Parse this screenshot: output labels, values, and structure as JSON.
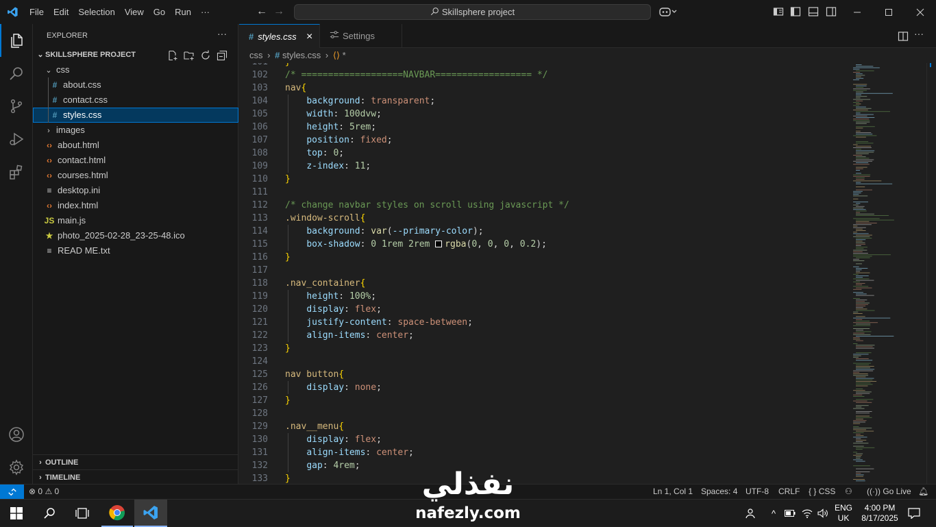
{
  "window": {
    "menu": [
      "File",
      "Edit",
      "Selection",
      "View",
      "Go",
      "Run",
      "···"
    ],
    "search_text": "Skillsphere project"
  },
  "sidebar": {
    "title": "EXPLORER",
    "more": "···",
    "project": "SKILLSPHERE PROJECT",
    "tree": [
      {
        "label": "css",
        "kind": "folder-open",
        "indent": 1
      },
      {
        "label": "about.css",
        "kind": "css",
        "indent": 2
      },
      {
        "label": "contact.css",
        "kind": "css",
        "indent": 2
      },
      {
        "label": "styles.css",
        "kind": "css",
        "indent": 2,
        "selected": true
      },
      {
        "label": "images",
        "kind": "folder",
        "indent": 1
      },
      {
        "label": "about.html",
        "kind": "html",
        "indent": 1
      },
      {
        "label": "contact.html",
        "kind": "html",
        "indent": 1
      },
      {
        "label": "courses.html",
        "kind": "html",
        "indent": 1
      },
      {
        "label": "desktop.ini",
        "kind": "ini",
        "indent": 1
      },
      {
        "label": "index.html",
        "kind": "html",
        "indent": 1
      },
      {
        "label": "main.js",
        "kind": "js",
        "indent": 1
      },
      {
        "label": "photo_2025-02-28_23-25-48.ico",
        "kind": "ico",
        "indent": 1
      },
      {
        "label": "READ ME.txt",
        "kind": "txt",
        "indent": 1
      }
    ],
    "outline": "OUTLINE",
    "timeline": "TIMELINE"
  },
  "tabs": [
    {
      "label": "styles.css",
      "icon": "#",
      "active": true,
      "close": "×"
    },
    {
      "label": "Settings",
      "icon": "settings-icon",
      "active": false
    }
  ],
  "breadcrumb": {
    "folder": "css",
    "file": "styles.css",
    "symbol": "*"
  },
  "editor": {
    "lines": [
      {
        "n": "102",
        "t": [
          [
            "c-com",
            "/* ===================NAVBAR================== */"
          ]
        ]
      },
      {
        "n": "103",
        "t": [
          [
            "c-sel",
            "nav"
          ],
          [
            "c-brace",
            "{"
          ]
        ]
      },
      {
        "n": "104",
        "t": [
          [
            "c-txt",
            "    "
          ],
          [
            "c-prop",
            "background"
          ],
          [
            "c-txt",
            ": "
          ],
          [
            "c-val",
            "transparent"
          ],
          [
            "c-txt",
            ";"
          ]
        ]
      },
      {
        "n": "105",
        "t": [
          [
            "c-txt",
            "    "
          ],
          [
            "c-prop",
            "width"
          ],
          [
            "c-txt",
            ": "
          ],
          [
            "c-num",
            "100dvw"
          ],
          [
            "c-txt",
            ";"
          ]
        ]
      },
      {
        "n": "106",
        "t": [
          [
            "c-txt",
            "    "
          ],
          [
            "c-prop",
            "height"
          ],
          [
            "c-txt",
            ": "
          ],
          [
            "c-num",
            "5rem"
          ],
          [
            "c-txt",
            ";"
          ]
        ]
      },
      {
        "n": "107",
        "t": [
          [
            "c-txt",
            "    "
          ],
          [
            "c-prop",
            "position"
          ],
          [
            "c-txt",
            ": "
          ],
          [
            "c-val",
            "fixed"
          ],
          [
            "c-txt",
            ";"
          ]
        ]
      },
      {
        "n": "108",
        "t": [
          [
            "c-txt",
            "    "
          ],
          [
            "c-prop",
            "top"
          ],
          [
            "c-txt",
            ": "
          ],
          [
            "c-num",
            "0"
          ],
          [
            "c-txt",
            ";"
          ]
        ]
      },
      {
        "n": "109",
        "t": [
          [
            "c-txt",
            "    "
          ],
          [
            "c-prop",
            "z-index"
          ],
          [
            "c-txt",
            ": "
          ],
          [
            "c-num",
            "11"
          ],
          [
            "c-txt",
            ";"
          ]
        ]
      },
      {
        "n": "110",
        "t": [
          [
            "c-brace",
            "}"
          ]
        ]
      },
      {
        "n": "111",
        "t": []
      },
      {
        "n": "112",
        "t": [
          [
            "c-com",
            "/* change navbar styles on scroll using javascript */"
          ]
        ]
      },
      {
        "n": "113",
        "t": [
          [
            "c-sel",
            ".window-scroll"
          ],
          [
            "c-brace",
            "{"
          ]
        ]
      },
      {
        "n": "114",
        "t": [
          [
            "c-txt",
            "    "
          ],
          [
            "c-prop",
            "background"
          ],
          [
            "c-txt",
            ": "
          ],
          [
            "c-fn",
            "var"
          ],
          [
            "c-txt",
            "("
          ],
          [
            "c-prop",
            "--primary-color"
          ],
          [
            "c-txt",
            ");"
          ]
        ]
      },
      {
        "n": "115",
        "t": [
          [
            "c-txt",
            "    "
          ],
          [
            "c-prop",
            "box-shadow"
          ],
          [
            "c-txt",
            ": "
          ],
          [
            "c-num",
            "0 1rem 2rem "
          ],
          [
            "swatch",
            ""
          ],
          [
            "c-fn",
            "rgba"
          ],
          [
            "c-txt",
            "("
          ],
          [
            "c-num",
            "0"
          ],
          [
            "c-txt",
            ", "
          ],
          [
            "c-num",
            "0"
          ],
          [
            "c-txt",
            ", "
          ],
          [
            "c-num",
            "0"
          ],
          [
            "c-txt",
            ", "
          ],
          [
            "c-num",
            "0.2"
          ],
          [
            "c-txt",
            ");"
          ]
        ]
      },
      {
        "n": "116",
        "t": [
          [
            "c-brace",
            "}"
          ]
        ]
      },
      {
        "n": "117",
        "t": []
      },
      {
        "n": "118",
        "t": [
          [
            "c-sel",
            ".nav_container"
          ],
          [
            "c-brace",
            "{"
          ]
        ]
      },
      {
        "n": "119",
        "t": [
          [
            "c-txt",
            "    "
          ],
          [
            "c-prop",
            "height"
          ],
          [
            "c-txt",
            ": "
          ],
          [
            "c-num",
            "100%"
          ],
          [
            "c-txt",
            ";"
          ]
        ]
      },
      {
        "n": "120",
        "t": [
          [
            "c-txt",
            "    "
          ],
          [
            "c-prop",
            "display"
          ],
          [
            "c-txt",
            ": "
          ],
          [
            "c-val",
            "flex"
          ],
          [
            "c-txt",
            ";"
          ]
        ]
      },
      {
        "n": "121",
        "t": [
          [
            "c-txt",
            "    "
          ],
          [
            "c-prop",
            "justify-content"
          ],
          [
            "c-txt",
            ": "
          ],
          [
            "c-val",
            "space-between"
          ],
          [
            "c-txt",
            ";"
          ]
        ]
      },
      {
        "n": "122",
        "t": [
          [
            "c-txt",
            "    "
          ],
          [
            "c-prop",
            "align-items"
          ],
          [
            "c-txt",
            ": "
          ],
          [
            "c-val",
            "center"
          ],
          [
            "c-txt",
            ";"
          ]
        ]
      },
      {
        "n": "123",
        "t": [
          [
            "c-brace",
            "}"
          ]
        ]
      },
      {
        "n": "124",
        "t": []
      },
      {
        "n": "125",
        "t": [
          [
            "c-sel",
            "nav button"
          ],
          [
            "c-brace",
            "{"
          ]
        ]
      },
      {
        "n": "126",
        "t": [
          [
            "c-txt",
            "    "
          ],
          [
            "c-prop",
            "display"
          ],
          [
            "c-txt",
            ": "
          ],
          [
            "c-val",
            "none"
          ],
          [
            "c-txt",
            ";"
          ]
        ]
      },
      {
        "n": "127",
        "t": [
          [
            "c-brace",
            "}"
          ]
        ]
      },
      {
        "n": "128",
        "t": []
      },
      {
        "n": "129",
        "t": [
          [
            "c-sel",
            ".nav__menu"
          ],
          [
            "c-brace",
            "{"
          ]
        ]
      },
      {
        "n": "130",
        "t": [
          [
            "c-txt",
            "    "
          ],
          [
            "c-prop",
            "display"
          ],
          [
            "c-txt",
            ": "
          ],
          [
            "c-val",
            "flex"
          ],
          [
            "c-txt",
            ";"
          ]
        ]
      },
      {
        "n": "131",
        "t": [
          [
            "c-txt",
            "    "
          ],
          [
            "c-prop",
            "align-items"
          ],
          [
            "c-txt",
            ": "
          ],
          [
            "c-val",
            "center"
          ],
          [
            "c-txt",
            ";"
          ]
        ]
      },
      {
        "n": "132",
        "t": [
          [
            "c-txt",
            "    "
          ],
          [
            "c-prop",
            "gap"
          ],
          [
            "c-txt",
            ": "
          ],
          [
            "c-num",
            "4rem"
          ],
          [
            "c-txt",
            ";"
          ]
        ]
      },
      {
        "n": "133",
        "t": [
          [
            "c-brace",
            "}"
          ]
        ]
      }
    ]
  },
  "status": {
    "errors": "0",
    "warnings": "0",
    "position": "Ln 1, Col 1",
    "spaces": "Spaces: 4",
    "encoding": "UTF-8",
    "eol": "CRLF",
    "language": "CSS",
    "golive": "Go Live"
  },
  "taskbar": {
    "lang1": "ENG",
    "lang2": "UK",
    "time": "4:00 PM",
    "date": "8/17/2025"
  },
  "watermark": {
    "arabic": "نفذلي",
    "domain": "nafezly.com"
  },
  "colors": {
    "accent": "#0078d4",
    "selection": "#04395e",
    "css_icon": "#519aba",
    "html_icon": "#e37933",
    "js_icon": "#cbcb41"
  }
}
